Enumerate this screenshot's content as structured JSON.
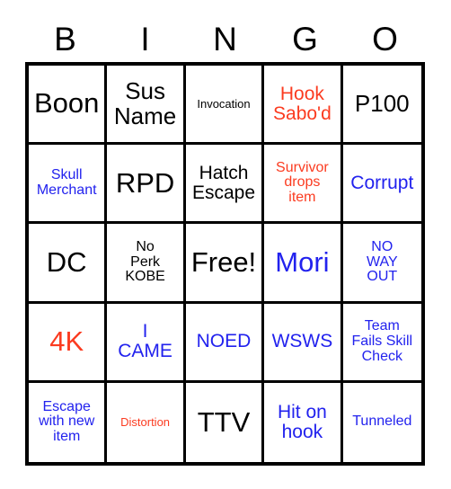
{
  "card": {
    "title_letters": [
      "B",
      "I",
      "N",
      "G",
      "O"
    ],
    "colors": {
      "black": "#000000",
      "red": "#fb3b20",
      "blue": "#2222ee",
      "grid_line": "#000000",
      "background": "#ffffff"
    },
    "grid_size": "5x5",
    "free_space_index": 12,
    "cells": [
      {
        "text": "Boon",
        "color": "black",
        "size": "xl"
      },
      {
        "text": "Sus\nName",
        "color": "black",
        "size": "lg"
      },
      {
        "text": "Invocation",
        "color": "black",
        "size": "xs"
      },
      {
        "text": "Hook\nSabo'd",
        "color": "red",
        "size": "md"
      },
      {
        "text": "P100",
        "color": "black",
        "size": "lg"
      },
      {
        "text": "Skull\nMerchant",
        "color": "blue",
        "size": "sm"
      },
      {
        "text": "RPD",
        "color": "black",
        "size": "xl"
      },
      {
        "text": "Hatch\nEscape",
        "color": "black",
        "size": "md"
      },
      {
        "text": "Survivor\ndrops\nitem",
        "color": "red",
        "size": "sm"
      },
      {
        "text": "Corrupt",
        "color": "blue",
        "size": "md"
      },
      {
        "text": "DC",
        "color": "black",
        "size": "xl"
      },
      {
        "text": "No\nPerk\nKOBE",
        "color": "black",
        "size": "sm"
      },
      {
        "text": "Free!",
        "color": "black",
        "size": "xl"
      },
      {
        "text": "Mori",
        "color": "blue",
        "size": "xl"
      },
      {
        "text": "NO\nWAY\nOUT",
        "color": "blue",
        "size": "sm"
      },
      {
        "text": "4K",
        "color": "red",
        "size": "xl"
      },
      {
        "text": "I\nCAME",
        "color": "blue",
        "size": "md"
      },
      {
        "text": "NOED",
        "color": "blue",
        "size": "md"
      },
      {
        "text": "WSWS",
        "color": "blue",
        "size": "md"
      },
      {
        "text": "Team\nFails Skill\nCheck",
        "color": "blue",
        "size": "sm"
      },
      {
        "text": "Escape\nwith new\nitem",
        "color": "blue",
        "size": "sm"
      },
      {
        "text": "Distortion",
        "color": "red",
        "size": "xs"
      },
      {
        "text": "TTV",
        "color": "black",
        "size": "xl"
      },
      {
        "text": "Hit on\nhook",
        "color": "blue",
        "size": "md"
      },
      {
        "text": "Tunneled",
        "color": "blue",
        "size": "sm"
      }
    ]
  }
}
